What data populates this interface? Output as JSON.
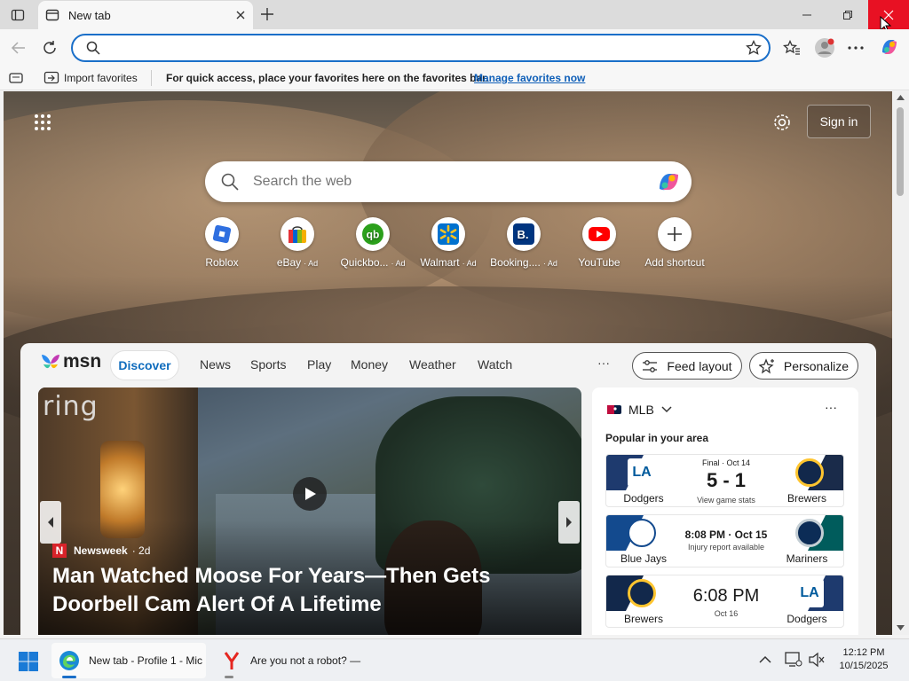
{
  "tab": {
    "title": "New tab",
    "new_tab_icon": "plus-icon"
  },
  "window": {
    "minimize_icon": "minimize-icon",
    "restore_icon": "restore-icon",
    "close_icon": "close-icon"
  },
  "toolbar": {
    "address_value": "",
    "icons": [
      "back-icon",
      "refresh-icon",
      "search-icon",
      "star-icon",
      "favorites-icon",
      "profile-icon",
      "more-icon",
      "copilot-icon"
    ]
  },
  "favorites_bar": {
    "import_label": "Import favorites",
    "message": "For quick access, place your favorites here on the favorites bar.",
    "manage_link": "Manage favorites now"
  },
  "newtab": {
    "sign_in": "Sign in",
    "search_placeholder": "Search the web",
    "shortcuts": [
      {
        "label": "Roblox",
        "ad": "",
        "color": "#2f6fe0"
      },
      {
        "label": "eBay",
        "ad": "· Ad",
        "color": "#e53238"
      },
      {
        "label": "Quickbo...",
        "ad": "· Ad",
        "color": "#2ca01c"
      },
      {
        "label": "Walmart",
        "ad": "· Ad",
        "color": "#0071ce"
      },
      {
        "label": "Booking....",
        "ad": "· Ad",
        "color": "#003580"
      },
      {
        "label": "YouTube",
        "ad": "",
        "color": "#ff0000"
      },
      {
        "label": "Add shortcut",
        "ad": "",
        "color": "#ffffff"
      }
    ]
  },
  "msn": {
    "logo": "msn",
    "nav": [
      "Discover",
      "News",
      "Sports",
      "Play",
      "Money",
      "Weather",
      "Watch"
    ],
    "more": "···",
    "feed_layout": "Feed layout",
    "personalize": "Personalize",
    "hero": {
      "ring_logo": "ring",
      "source": "Newsweek",
      "age": "· 2d",
      "headline": "Man Watched Moose For Years—Then Gets Doorbell Cam Alert Of A Lifetime"
    },
    "mlb": {
      "title": "MLB",
      "subtitle": "Popular in your area",
      "games": [
        {
          "home": "Dodgers",
          "away": "Brewers",
          "status": "Final · Oct 14",
          "score": "5 - 1",
          "sub": "View game stats",
          "left_color": "#1e3a6e",
          "right_color": "#1a2b4a"
        },
        {
          "home": "Blue Jays",
          "away": "Mariners",
          "status": "8:08 PM · Oct 15",
          "score": "",
          "sub": "Injury report available",
          "left_color": "#134a8e",
          "right_color": "#005c5c"
        },
        {
          "home": "Brewers",
          "away": "Dodgers",
          "status": "",
          "score": "6:08 PM",
          "sub": "Oct 16",
          "left_color": "#12284b",
          "right_color": "#1e3a6e"
        }
      ]
    }
  },
  "taskbar": {
    "apps": [
      {
        "label": "New tab - Profile 1 - Mic",
        "icon": "edge-icon"
      },
      {
        "label": "Are you not a robot? —",
        "icon": "yandex-icon"
      }
    ],
    "time": "12:12 PM",
    "date": "10/15/2025"
  }
}
